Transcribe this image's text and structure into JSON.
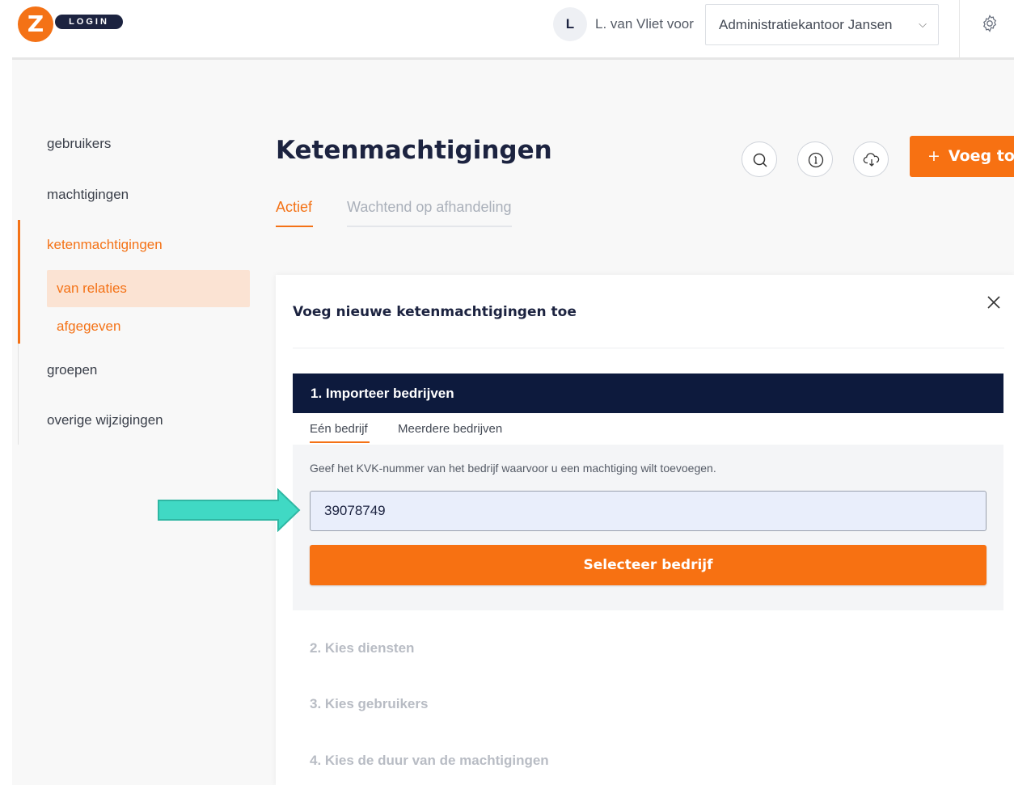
{
  "header": {
    "logo_letter": "Z",
    "logo_text": "LOGIN",
    "avatar_initial": "L",
    "user_text": "L. van Vliet voor",
    "org_select_value": "Administratiekantoor Jansen"
  },
  "sidebar": {
    "items": [
      {
        "label": "gebruikers"
      },
      {
        "label": "machtigingen"
      },
      {
        "label": "ketenmachtigingen"
      },
      {
        "label": "groepen"
      },
      {
        "label": "overige wijzigingen"
      }
    ],
    "subitems": [
      {
        "label": "van relaties"
      },
      {
        "label": "afgegeven"
      }
    ]
  },
  "page": {
    "title": "Ketenmachtigingen",
    "add_button_label": "Voeg toe",
    "add_button_plus": "+",
    "tabs": [
      {
        "label": "Actief"
      },
      {
        "label": "Wachtend op afhandeling"
      }
    ]
  },
  "modal": {
    "title": "Voeg nieuwe ketenmachtigingen toe",
    "step1_title": "1. Importeer bedrijven",
    "subtabs": [
      {
        "label": "Eén bedrijf"
      },
      {
        "label": "Meerdere bedrijven"
      }
    ],
    "hint": "Geef het KVK-nummer van het bedrijf waarvoor u een machtiging wilt toevoegen.",
    "kvk_value": "39078749",
    "select_button_label": "Selecteer bedrijf",
    "steps_disabled": [
      {
        "label": "2. Kies diensten"
      },
      {
        "label": "3. Kies gebruikers"
      },
      {
        "label": "4. Kies de duur van de machtigingen"
      }
    ]
  },
  "colors": {
    "accent": "#f47216",
    "navy": "#0d1a3d",
    "arrow": "#40d9c4"
  },
  "icons": [
    "logo-icon",
    "chevron-down-icon",
    "gear-icon",
    "search-icon",
    "info-icon",
    "cloud-download-icon",
    "close-icon",
    "arrow-right-icon"
  ]
}
